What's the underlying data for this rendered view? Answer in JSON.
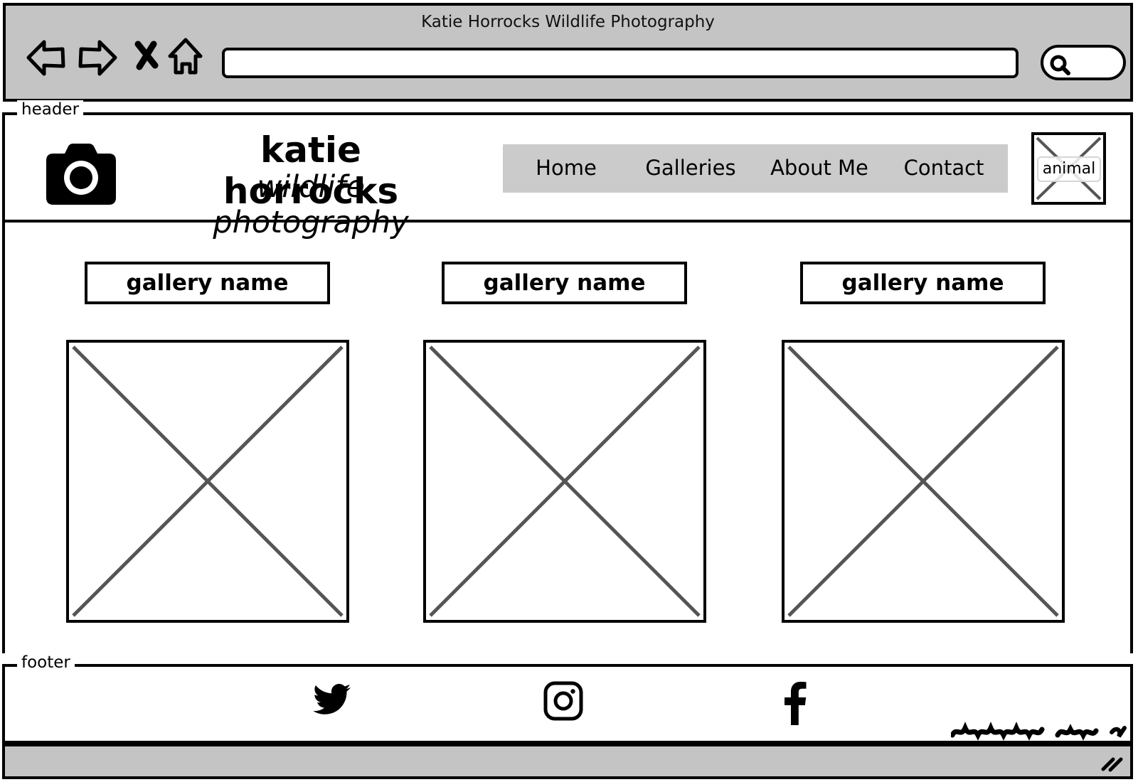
{
  "browser": {
    "window_title": "Katie Horrocks Wildlife Photography",
    "url": "",
    "back_icon": "arrow-left-icon",
    "forward_icon": "arrow-right-icon",
    "stop_icon": "close-icon",
    "home_icon": "home-icon",
    "search_icon": "search-icon"
  },
  "header": {
    "legend": "header",
    "logo_icon": "camera-icon",
    "title": "katie horrocks",
    "subtitle": "wildlife photography",
    "nav": [
      {
        "label": "Home"
      },
      {
        "label": "Galleries"
      },
      {
        "label": "About Me"
      },
      {
        "label": "Contact"
      }
    ],
    "image_label": "animal"
  },
  "galleries": [
    {
      "name": "gallery name"
    },
    {
      "name": "gallery name"
    },
    {
      "name": "gallery name"
    }
  ],
  "footer": {
    "legend": "footer",
    "social": [
      {
        "icon": "twitter-icon"
      },
      {
        "icon": "instagram-icon"
      },
      {
        "icon": "facebook-icon"
      }
    ]
  },
  "colors": {
    "chrome": "#c4c4c4",
    "nav_background": "#cbcbcb",
    "placeholder_cross": "#555555"
  }
}
